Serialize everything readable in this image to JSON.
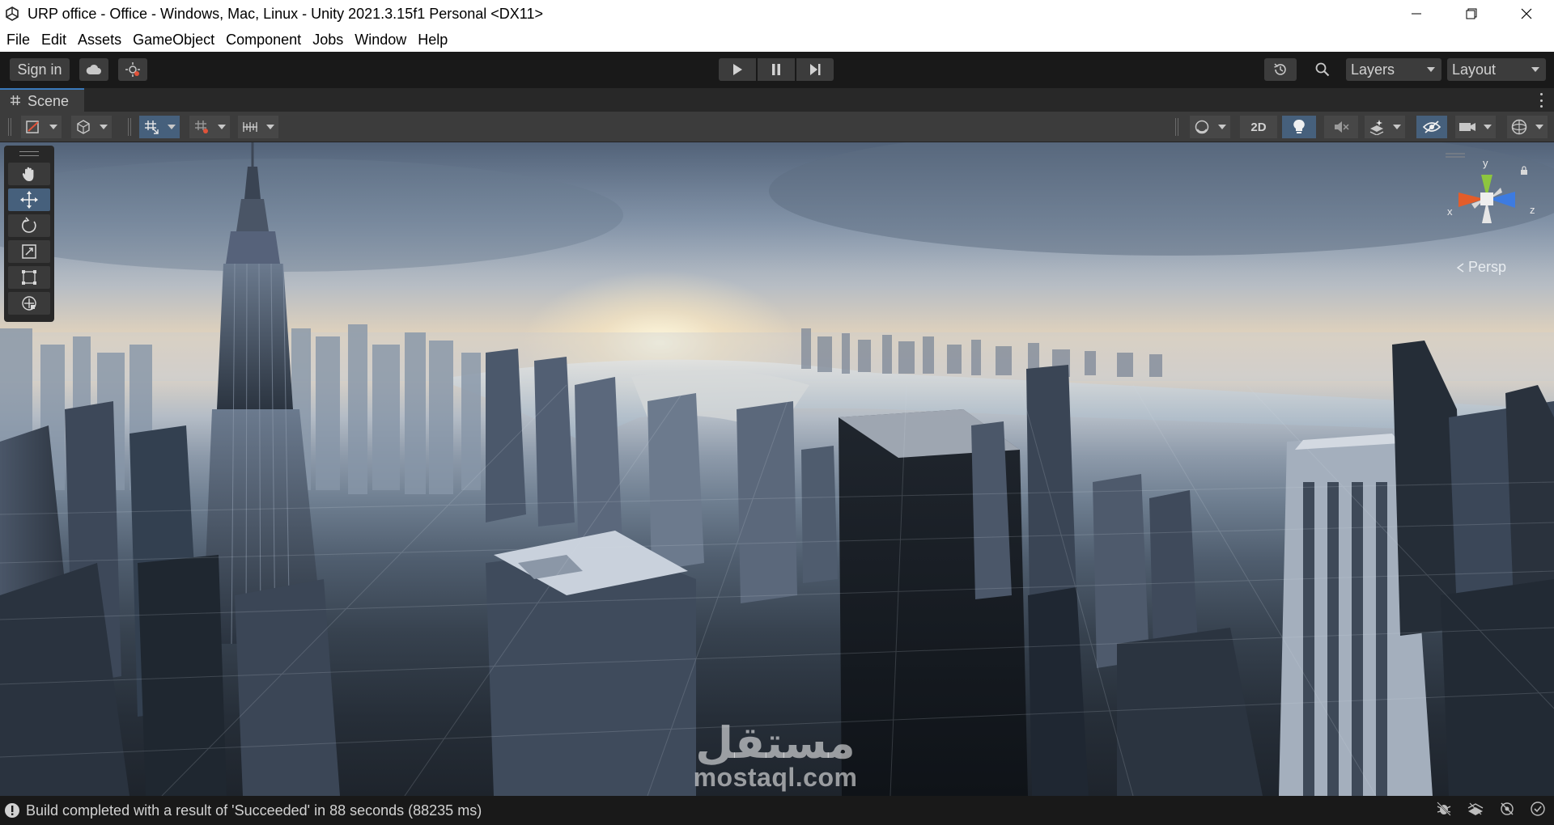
{
  "window": {
    "title": "URP office - Office - Windows, Mac, Linux - Unity 2021.3.15f1 Personal <DX11>",
    "controls": [
      "minimize-icon",
      "restore-icon",
      "close-icon"
    ]
  },
  "menubar": {
    "items": [
      "File",
      "Edit",
      "Assets",
      "GameObject",
      "Component",
      "Jobs",
      "Window",
      "Help"
    ]
  },
  "toolbar": {
    "sign_in": "Sign in",
    "icons": [
      "cloud-icon",
      "collab-icon",
      "play-icon",
      "pause-icon",
      "step-icon",
      "history-icon",
      "search-icon"
    ],
    "layers_label": "Layers",
    "layout_label": "Layout"
  },
  "scene": {
    "tab_label": "Scene",
    "toolbar": {
      "btn_2d": "2D",
      "icons": [
        "draw-mode-icon",
        "render-mode-icon",
        "grid-snap-icon",
        "increment-snap-icon",
        "ruler-icon",
        "shading-sphere-icon",
        "lighting-icon",
        "audio-mute-icon",
        "effects-icon",
        "hidden-visibility-icon",
        "camera-icon",
        "gizmos-icon"
      ]
    },
    "tools": [
      "hand-tool-icon",
      "move-tool-icon",
      "rotate-tool-icon",
      "scale-tool-icon",
      "rect-tool-icon",
      "transform-tool-icon"
    ],
    "active_tool": "move-tool-icon",
    "gizmo": {
      "axis_y": "y",
      "axis_x": "x",
      "axis_z": "z",
      "projection": "Persp"
    }
  },
  "watermark": {
    "arabic": "مستقل",
    "latin": "mostaql.com"
  },
  "status": {
    "message": "Build completed with a result of 'Succeeded' in 88 seconds (88235 ms)",
    "icons": [
      "debug-icon",
      "progress-icon",
      "network-icon",
      "check-icon"
    ]
  },
  "colors": {
    "accent": "#3a79bb",
    "active_tool_bg": "#46607c",
    "panel_bg": "#3c3c3c",
    "dark_bg": "#191919"
  }
}
